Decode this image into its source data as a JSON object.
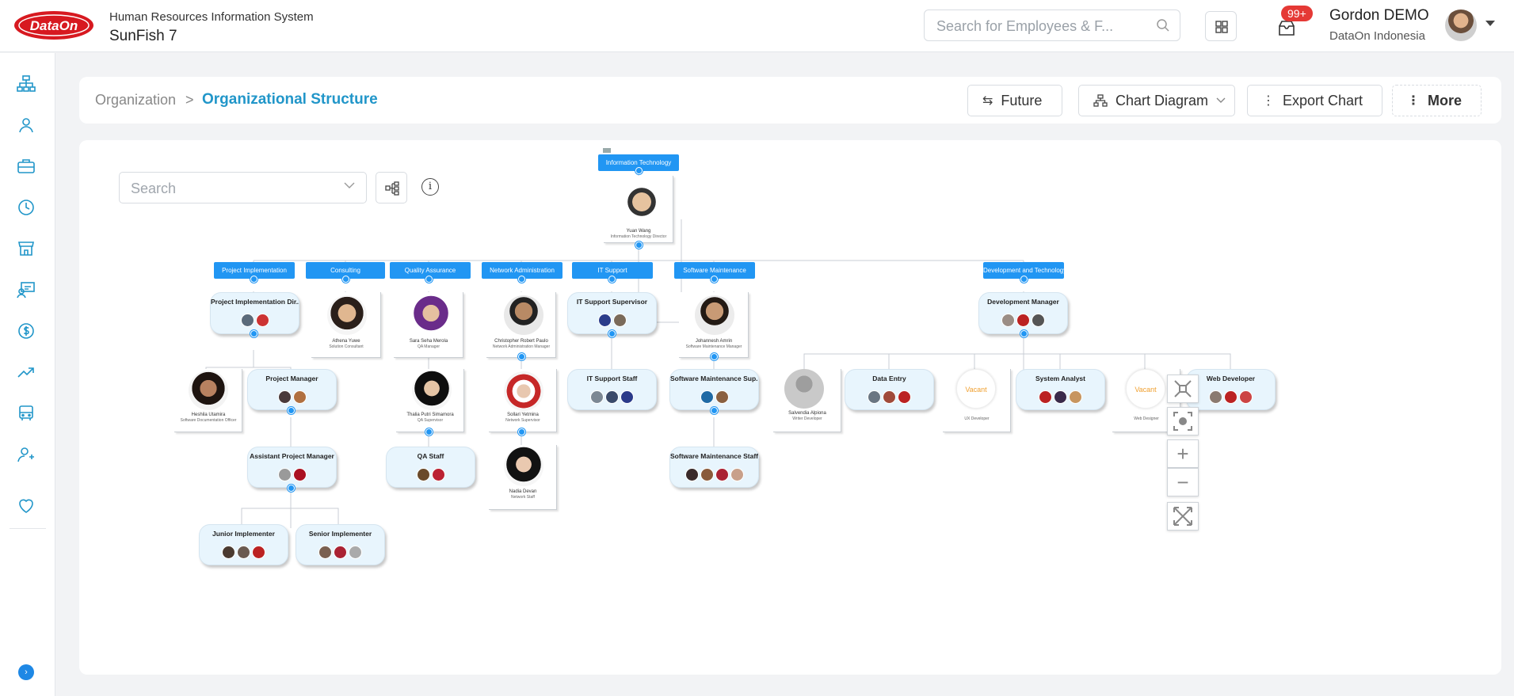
{
  "app": {
    "logo_text": "DataOn",
    "title": "Human Resources Information System",
    "product": "SunFish 7"
  },
  "search": {
    "placeholder": "Search for Employees & F..."
  },
  "notifications": {
    "badge": "99+"
  },
  "user": {
    "name": "Gordon DEMO",
    "org": "DataOn Indonesia"
  },
  "sidebar": {
    "items": [
      {
        "icon": "org-chart-icon"
      },
      {
        "icon": "person-icon"
      },
      {
        "icon": "briefcase-icon"
      },
      {
        "icon": "clock-icon"
      },
      {
        "icon": "store-icon"
      },
      {
        "icon": "training-icon"
      },
      {
        "icon": "dollar-icon"
      },
      {
        "icon": "trend-icon"
      },
      {
        "icon": "bus-icon"
      },
      {
        "icon": "user-add-icon"
      },
      {
        "icon": "heart-icon"
      }
    ]
  },
  "breadcrumb": {
    "parent": "Organization",
    "separator": ">",
    "current": "Organizational Structure"
  },
  "toolbar": {
    "future": "Future",
    "chart_diagram": "Chart Diagram",
    "export_chart": "Export Chart",
    "more": "More"
  },
  "chart_search": {
    "placeholder": "Search"
  },
  "org": {
    "root": {
      "dept": "Information Technology",
      "name": "Yuan Wang",
      "position": "Information Technology Director"
    },
    "departments": [
      "Project Implementation",
      "Consulting",
      "Quality Assurance",
      "Network Administration",
      "IT Support",
      "Software Maintenance",
      "Development and Technology"
    ],
    "cards": {
      "project_impl_dir": "Project Implementation Dir...",
      "project_manager": "Project Manager",
      "assistant_pm": "Assistant Project Manager",
      "junior_impl": "Junior Implementer",
      "senior_impl": "Senior Implementer",
      "qa_staff": "QA Staff",
      "it_support_supervisor": "IT Support Supervisor",
      "it_support_staff": "IT Support Staff",
      "sw_maint_sup": "Software Maintenance Sup...",
      "sw_maint_staff": "Software Maintenance Staff",
      "dev_manager": "Development Manager",
      "data_entry": "Data Entry",
      "system_analyst": "System Analyst",
      "web_developer": "Web Developer"
    },
    "people": {
      "consultant": {
        "name": "Athena Yuwe",
        "position": "Solution Consultant"
      },
      "qa_manager": {
        "name": "Sara Seha Merola",
        "position": "QA Manager"
      },
      "network_manager": {
        "name": "Christopher Robert Paulo",
        "position": "Network Administration Manager"
      },
      "sw_manager": {
        "name": "Johannesh Amrin",
        "position": "Software Maintenance Manager"
      },
      "doc_officer": {
        "name": "Heshila Utamira",
        "position": "Software Documentation Officer"
      },
      "qa_supervisor": {
        "name": "Thalia Putri Simamora",
        "position": "QA Supervisor"
      },
      "network_supervisor": {
        "name": "Sollari Yetmina",
        "position": "Network Supervisor"
      },
      "network_staff": {
        "name": "Nadia Devan",
        "position": "Network Staff"
      },
      "writer": {
        "name": "Salvendia Alpiona",
        "position": "Writer Developer"
      }
    },
    "vacant": {
      "label": "Vacant",
      "ui_position": "UX Developer",
      "web_position": "Web Designer"
    }
  },
  "zoom_tools": {
    "collapse": "collapse-icon",
    "center": "center-icon",
    "zoom_in": "+",
    "zoom_out": "−",
    "fit": "fit-icon"
  }
}
